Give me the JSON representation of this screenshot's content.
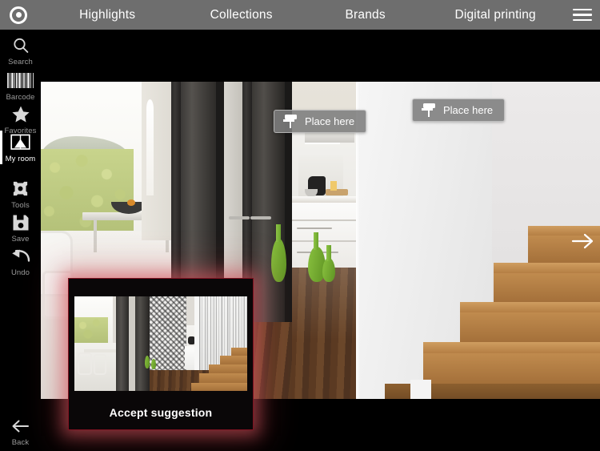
{
  "app": {
    "logo_icon": "target-circle-logo",
    "background_color": "#000000",
    "navbar_color": "#6e6e6e",
    "accent_glow_color": "#d65660"
  },
  "topnav": {
    "items": [
      {
        "label": "Highlights",
        "name": "nav-item-highlights"
      },
      {
        "label": "Collections",
        "name": "nav-item-collections"
      },
      {
        "label": "Brands",
        "name": "nav-item-brands"
      },
      {
        "label": "Digital printing",
        "name": "nav-item-digital-printing"
      }
    ],
    "menu_icon": "hamburger-menu-icon"
  },
  "sidebar": {
    "items": [
      {
        "label": "Search",
        "icon": "search-icon",
        "active": false
      },
      {
        "label": "Barcode",
        "icon": "barcode-icon",
        "active": false
      },
      {
        "label": "Favorites",
        "icon": "star-icon",
        "active": false
      },
      {
        "label": "My room",
        "icon": "room-image-icon",
        "active": true
      },
      {
        "label": "Tools",
        "icon": "gear-icon",
        "active": false
      },
      {
        "label": "Save",
        "icon": "floppy-disk-icon",
        "active": false
      },
      {
        "label": "Undo",
        "icon": "undo-arrow-icon",
        "active": false
      }
    ],
    "back": {
      "label": "Back",
      "icon": "arrow-left-icon"
    }
  },
  "stage": {
    "place_buttons": [
      {
        "label": "Place here",
        "icon": "paint-roller-icon",
        "target": "kitchen-wall"
      },
      {
        "label": "Place here",
        "icon": "paint-roller-icon",
        "target": "hall-wall"
      }
    ],
    "next_arrow_icon": "arrow-right-icon",
    "scene_description": "interior-room-photo"
  },
  "suggestion": {
    "accept_label": "Accept suggestion",
    "thumbnail_name": "suggestion-preview-thumbnail"
  }
}
